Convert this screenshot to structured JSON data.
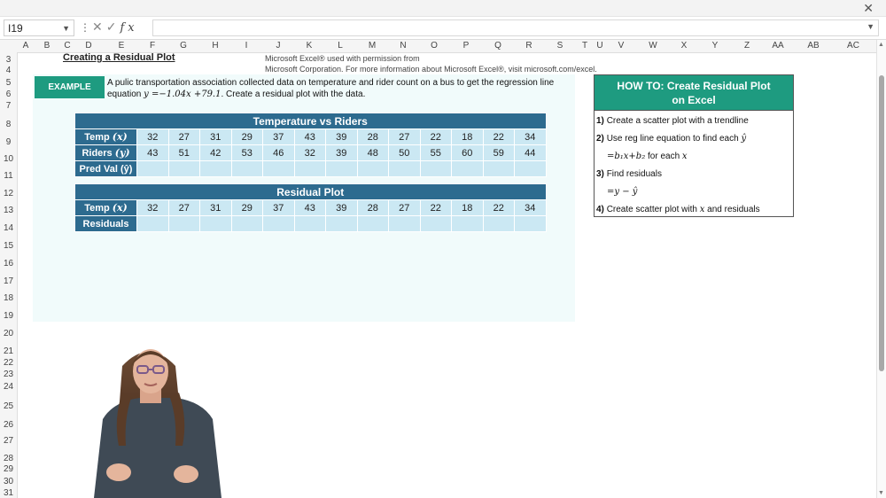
{
  "window": {
    "close_glyph": "✕"
  },
  "formula_bar": {
    "name_box": "I19",
    "fx_label": "fx",
    "formula": ""
  },
  "columns": [
    "A",
    "B",
    "C",
    "D",
    "E",
    "F",
    "G",
    "H",
    "I",
    "J",
    "K",
    "L",
    "M",
    "N",
    "O",
    "P",
    "Q",
    "R",
    "S",
    "T",
    "U",
    "V",
    "W",
    "X",
    "Y",
    "Z",
    "AA",
    "AB",
    "AC"
  ],
  "rows": [
    "3",
    "4",
    "5",
    "6",
    "7",
    "8",
    "9",
    "10",
    "11",
    "12",
    "13",
    "14",
    "15",
    "16",
    "17",
    "18",
    "19",
    "20",
    "21",
    "22",
    "23",
    "24",
    "25",
    "26",
    "27",
    "28",
    "29",
    "30",
    "31"
  ],
  "sheet": {
    "heading": "Creating a Residual Plot",
    "credit_line1": "Microsoft Excel® used with permission from",
    "credit_line2": "Microsoft Corporation. For more information about Microsoft Excel®, visit microsoft.com/excel.",
    "example_label": "EXAMPLE",
    "problem_pre": "A pulic transportation association collected data on temperature and rider count on a bus to get the regression line equation ",
    "problem_eq": "y =−1.04x +79.1",
    "problem_post": ". Create a residual plot with the data."
  },
  "table1": {
    "title": "Temperature vs Riders",
    "temp_label_text": "Temp ",
    "temp_label_var": "(x)",
    "riders_label_text": "Riders ",
    "riders_label_var": "(y)",
    "pred_label": "Pred Val (ŷ)",
    "temps": [
      "32",
      "27",
      "31",
      "29",
      "37",
      "43",
      "39",
      "28",
      "27",
      "22",
      "18",
      "22",
      "34"
    ],
    "riders": [
      "43",
      "51",
      "42",
      "53",
      "46",
      "32",
      "39",
      "48",
      "50",
      "55",
      "60",
      "59",
      "44"
    ]
  },
  "table2": {
    "title": "Residual Plot",
    "temp_label_text": "Temp ",
    "temp_label_var": "(x)",
    "residuals_label": "Residuals",
    "temps": [
      "32",
      "27",
      "31",
      "29",
      "37",
      "43",
      "39",
      "28",
      "27",
      "22",
      "18",
      "22",
      "34"
    ]
  },
  "howto": {
    "title_line1": "HOW TO: Create Residual Plot",
    "title_line2": "on Excel",
    "step1_num": "1)",
    "step1": "Create a scatter plot with a trendline",
    "step2_num": "2)",
    "step2": "Use reg line equation to find each ",
    "step2_var": "ŷ",
    "step2b": "=b₁x+b₂",
    "step2b_post": " for each ",
    "step2b_var": "x",
    "step3_num": "3)",
    "step3": "Find residuals",
    "step3b": "=y − ŷ",
    "step4_num": "4)",
    "step4": "Create scatter plot with ",
    "step4_var": "x",
    "step4_post": " and residuals"
  },
  "colors": {
    "teal": "#1e9b80",
    "navy": "#2d6b8f",
    "cell": "#cbe8f3",
    "panel": "#f1fbfb"
  }
}
